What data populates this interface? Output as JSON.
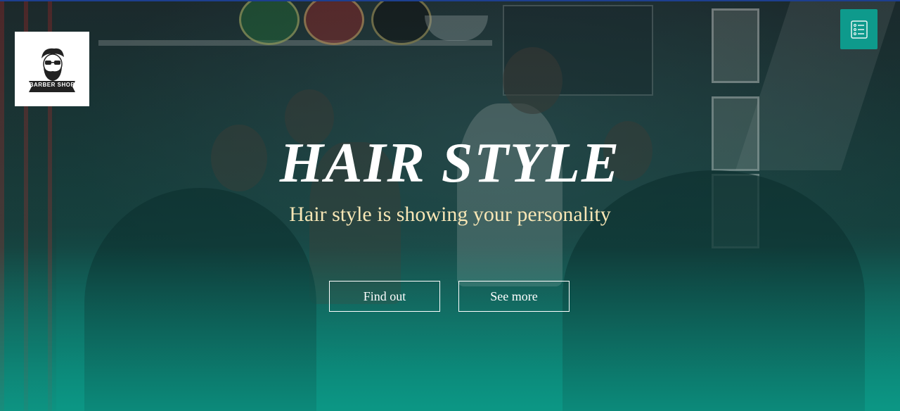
{
  "header": {
    "logo": {
      "text": "BARBER SHOP",
      "icon": "barber-logo-icon"
    },
    "menu_button": {
      "icon": "list-menu-icon",
      "color": "#0e9a8c"
    }
  },
  "hero": {
    "title": "HAIR STYLE",
    "subtitle": "Hair style is showing your personality",
    "buttons": [
      {
        "label": "Find out"
      },
      {
        "label": "See more"
      }
    ],
    "colors": {
      "title": "#ffffff",
      "subtitle": "#f7e6b5",
      "accent": "#0e9a8c"
    }
  }
}
